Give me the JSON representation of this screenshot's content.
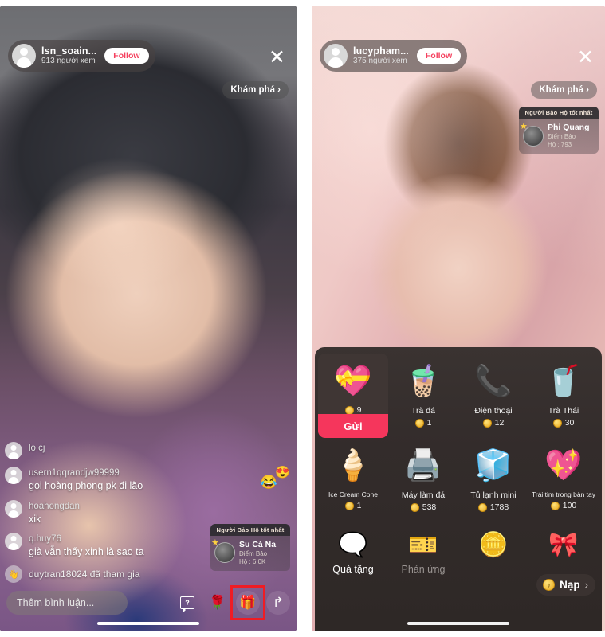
{
  "left": {
    "host": {
      "name": "lsn_soain...",
      "viewers": "913 người xem",
      "follow_label": "Follow",
      "avatar_icon": "person-avatar-icon"
    },
    "close_icon": "close-icon",
    "explore_label": "Khám phá ›",
    "supporter": {
      "title": "Người Bảo Hộ tốt nhất",
      "name": "Su Cà Na",
      "line1": "Điểm Bảo",
      "line2": "Hộ : 6.0K",
      "crown_icon": "crown-icon"
    },
    "comments": [
      {
        "user": "lo cj",
        "text": "",
        "type": "comment"
      },
      {
        "user": "usern1qqrandjw99999",
        "text": "gọi hoàng phong pk đi lão",
        "type": "comment"
      },
      {
        "user": "hoahongdan",
        "text": "xik",
        "type": "comment"
      },
      {
        "user": "q.huy76",
        "text": "già vẫn thấy xinh là sao ta",
        "type": "comment"
      },
      {
        "user": "duytran18024 đã tham gia",
        "text": "",
        "type": "join"
      }
    ],
    "bottom": {
      "input_placeholder": "Thêm bình luận...",
      "icons": [
        {
          "name": "question-box-icon",
          "glyph": "?"
        },
        {
          "name": "rose-gift-icon",
          "glyph": "🌹"
        },
        {
          "name": "gift-icon",
          "glyph": "🎁"
        },
        {
          "name": "share-icon",
          "glyph": "➦"
        }
      ],
      "highlight_color": "#ef1c24",
      "highlighted_icon": "gift-icon"
    }
  },
  "right": {
    "host": {
      "name": "lucypham...",
      "viewers": "375 người xem",
      "follow_label": "Follow",
      "avatar_icon": "person-avatar-icon"
    },
    "close_icon": "close-icon",
    "explore_label": "Khám phá ›",
    "supporter": {
      "title": "Người Bảo Hộ tốt nhất",
      "name": "Phi Quang",
      "line1": "Điểm Bảo",
      "line2": "Hộ : 793",
      "crown_icon": "crown-icon"
    },
    "gift_panel": {
      "gifts": [
        {
          "name": "",
          "price": "9",
          "icon": "winged-heart-icon",
          "glyph": "💝",
          "selected": true,
          "send_label": "Gửi"
        },
        {
          "name": "Trà đá",
          "price": "1",
          "icon": "iced-tea-icon",
          "glyph": "🧋",
          "selected": false
        },
        {
          "name": "Điện thoại",
          "price": "12",
          "icon": "phone-icon",
          "glyph": "📞",
          "selected": false
        },
        {
          "name": "Trà Thái",
          "price": "30",
          "icon": "thai-tea-icon",
          "glyph": "🥤",
          "selected": false
        },
        {
          "name": "Ice Cream Cone",
          "price": "1",
          "icon": "ice-cream-cone-icon",
          "glyph": "🍦",
          "selected": false
        },
        {
          "name": "Máy làm đá",
          "price": "538",
          "icon": "ice-maker-icon",
          "glyph": "🖨",
          "selected": false
        },
        {
          "name": "Tủ lạnh mini",
          "price": "1788",
          "icon": "mini-fridge-icon",
          "glyph": "🧊",
          "selected": false
        },
        {
          "name": "Trái tim trong bàn tay",
          "price": "100",
          "icon": "heart-in-hands-icon",
          "glyph": "💖",
          "selected": false
        }
      ],
      "tabs": [
        {
          "label": "Quà tặng",
          "icon": "gift-bubble-icon",
          "glyph": "◯",
          "active": true
        },
        {
          "label": "Phản ứng",
          "icon": "tiktok-box-icon",
          "glyph": "🎫",
          "active": false
        }
      ],
      "extra_icons": [
        {
          "name": "coins-pile-icon",
          "glyph": "🪙"
        },
        {
          "name": "ribbon-icon",
          "glyph": "🎀"
        }
      ],
      "recharge": {
        "label": "Nạp",
        "coin_icon": "coin-icon",
        "chevron_icon": "chevron-right-icon"
      }
    }
  },
  "colors": {
    "accent_red": "#f5365c",
    "highlight_red": "#ef1c24",
    "coin_gold": "#e8a81c",
    "panel_dark": "#332c2b"
  }
}
